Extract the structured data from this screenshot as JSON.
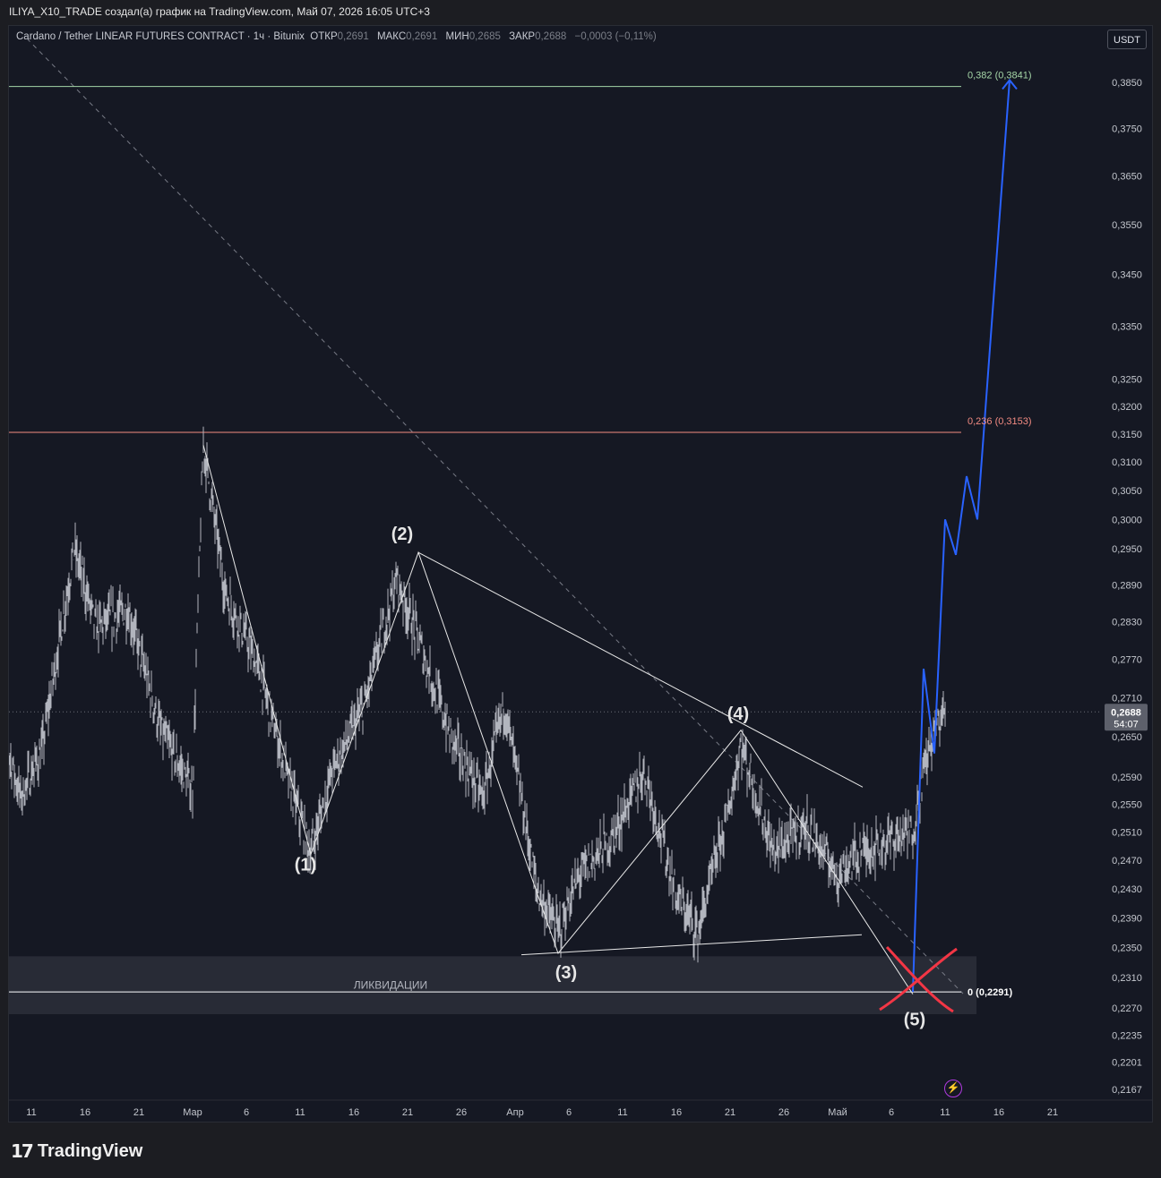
{
  "header": {
    "byline": "ILIYA_X10_TRADE создал(а) график на TradingView.com, Май 07, 2026 16:05 UTC+3"
  },
  "legend": {
    "symbol": "Cardano / Tether LINEAR FUTURES CONTRACT · 1ч · Bitunix",
    "open_label": "ОТКР",
    "open": "0,2691",
    "high_label": "МАКС",
    "high": "0,2691",
    "low_label": "МИН",
    "low": "0,2685",
    "close_label": "ЗАКР",
    "close": "0,2688",
    "change": "−0,0003 (−0,11%)"
  },
  "currency_button": "USDT",
  "footer": {
    "brand": "TradingView"
  },
  "colors": {
    "background": "#151823",
    "candles": "#b2b5be",
    "fib_0382": "#a5d6a7",
    "fib_0236": "#f28b82",
    "projection": "#2962ff",
    "cross": "#f23645",
    "liquidation_zone": "#2a2e39"
  },
  "chart_data": {
    "type": "line",
    "title": "Cardano / Tether LINEAR FUTURES CONTRACT · 1ч · Bitunix",
    "timeframe": "1ч",
    "y_axis": {
      "ticks": [
        "0,3850",
        "0,3750",
        "0,3650",
        "0,3550",
        "0,3450",
        "0,3350",
        "0,3250",
        "0,3200",
        "0,3150",
        "0,3100",
        "0,3050",
        "0,3000",
        "0,2950",
        "0,2890",
        "0,2830",
        "0,2770",
        "0,2710",
        "0,2650",
        "0,2590",
        "0,2550",
        "0,2510",
        "0,2470",
        "0,2430",
        "0,2390",
        "0,2350",
        "0,2310",
        "0,2270",
        "0,2235",
        "0,2201",
        "0,2167"
      ],
      "log_scale": true,
      "range": [
        0.215,
        0.39
      ]
    },
    "x_axis": {
      "ticks": [
        "11",
        "16",
        "21",
        "Мар",
        "6",
        "11",
        "16",
        "21",
        "26",
        "Апр",
        "6",
        "11",
        "16",
        "21",
        "26",
        "Май",
        "6",
        "11",
        "16",
        "21"
      ]
    },
    "last_price": {
      "value": 0.2688,
      "label": "0,2688",
      "countdown": "54:07"
    },
    "price_series_approx": [
      {
        "x": "Feb 08",
        "y": 0.268
      },
      {
        "x": "Feb 10",
        "y": 0.256
      },
      {
        "x": "Feb 12",
        "y": 0.263
      },
      {
        "x": "Feb 15",
        "y": 0.295
      },
      {
        "x": "Feb 17",
        "y": 0.282
      },
      {
        "x": "Feb 20",
        "y": 0.285
      },
      {
        "x": "Feb 23",
        "y": 0.266
      },
      {
        "x": "Feb 26",
        "y": 0.257
      },
      {
        "x": "Feb 27",
        "y": 0.313
      },
      {
        "x": "Mar 01",
        "y": 0.288
      },
      {
        "x": "Mar 04",
        "y": 0.276
      },
      {
        "x": "Mar 07",
        "y": 0.258
      },
      {
        "x": "Mar 09",
        "y": 0.248
      },
      {
        "x": "Mar 11",
        "y": 0.26
      },
      {
        "x": "Mar 14",
        "y": 0.27
      },
      {
        "x": "Mar 17",
        "y": 0.29
      },
      {
        "x": "Mar 19",
        "y": 0.28
      },
      {
        "x": "Mar 22",
        "y": 0.265
      },
      {
        "x": "Mar 25",
        "y": 0.256
      },
      {
        "x": "Mar 27",
        "y": 0.27
      },
      {
        "x": "Mar 30",
        "y": 0.243
      },
      {
        "x": "Apr 01",
        "y": 0.237
      },
      {
        "x": "Apr 03",
        "y": 0.245
      },
      {
        "x": "Apr 06",
        "y": 0.25
      },
      {
        "x": "Apr 09",
        "y": 0.26
      },
      {
        "x": "Apr 12",
        "y": 0.242
      },
      {
        "x": "Apr 14",
        "y": 0.237
      },
      {
        "x": "Apr 17",
        "y": 0.255
      },
      {
        "x": "Apr 18",
        "y": 0.264
      },
      {
        "x": "Apr 21",
        "y": 0.248
      },
      {
        "x": "Apr 24",
        "y": 0.252
      },
      {
        "x": "Apr 27",
        "y": 0.245
      },
      {
        "x": "Apr 29",
        "y": 0.248
      },
      {
        "x": "May 02",
        "y": 0.25
      },
      {
        "x": "May 04",
        "y": 0.251
      },
      {
        "x": "May 05",
        "y": 0.26
      },
      {
        "x": "May 06",
        "y": 0.266
      },
      {
        "x": "May 07",
        "y": 0.2688
      }
    ],
    "fib_levels": [
      {
        "label": "0,382 (0,3841)",
        "ratio": 0.382,
        "price": 0.3841,
        "color": "#a5d6a7"
      },
      {
        "label": "0,236 (0,3153)",
        "ratio": 0.236,
        "price": 0.3153,
        "color": "#f28b82"
      },
      {
        "label": "0 (0,2291)",
        "ratio": 0,
        "price": 0.2291,
        "color": "#ffffff"
      }
    ],
    "zone": {
      "label": "ЛИКВИДАЦИИ",
      "from": 0.2262,
      "to": 0.2338
    },
    "wave_labels": [
      {
        "label": "(1)",
        "price": 0.2478
      },
      {
        "label": "(2)",
        "price": 0.2944
      },
      {
        "label": "(3)",
        "price": 0.2342
      },
      {
        "label": "(4)",
        "price": 0.266
      },
      {
        "label": "(5)",
        "price": 0.2288
      }
    ],
    "wave_path": [
      {
        "x": "Feb 27",
        "y": 0.313
      },
      {
        "x": "Mar 09",
        "y": 0.2478
      },
      {
        "x": "Mar 19",
        "y": 0.2944
      },
      {
        "x": "Apr 01",
        "y": 0.2342
      },
      {
        "x": "Apr 18",
        "y": 0.266
      },
      {
        "x": "May 04",
        "y": 0.2288
      }
    ],
    "projection": [
      {
        "x": "May 04",
        "y": 0.2291
      },
      {
        "x": "May 05",
        "y": 0.2755
      },
      {
        "x": "May 06",
        "y": 0.2625
      },
      {
        "x": "May 07",
        "y": 0.3
      },
      {
        "x": "May 08",
        "y": 0.294
      },
      {
        "x": "May 09",
        "y": 0.3075
      },
      {
        "x": "May 10",
        "y": 0.3
      },
      {
        "x": "May 13",
        "y": 0.3855
      }
    ]
  }
}
